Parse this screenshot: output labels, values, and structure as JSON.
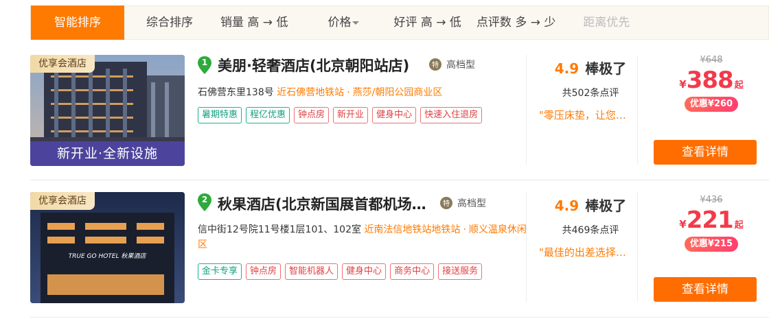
{
  "sort_bar": {
    "tabs": [
      {
        "label": "智能排序"
      },
      {
        "label": "综合排序"
      },
      {
        "label": "销量 高 → 低"
      },
      {
        "label": "价格"
      },
      {
        "label": "好评 高 → 低"
      },
      {
        "label": "点评数 多 → 少"
      },
      {
        "label": "距离优先"
      }
    ],
    "active_index": 0,
    "accent_color": "#ff7a00"
  },
  "hotels": [
    {
      "rank": "1",
      "name": "美朋·轻奢酒店(北京朝阳站店)",
      "grade": "高档型",
      "member_tag": "优享会酒店",
      "photo_promo": "新开业·全新设施",
      "address": "石佛营东里138号",
      "nearby": "近石佛营地铁站",
      "area": "燕莎/朝阳公园商业区",
      "tags": [
        {
          "label": "暑期特惠",
          "style": "green"
        },
        {
          "label": "程亿优惠",
          "style": "green"
        },
        {
          "label": "钟点房",
          "style": "red"
        },
        {
          "label": "新开业",
          "style": "red"
        },
        {
          "label": "健身中心",
          "style": "red"
        },
        {
          "label": "快速入住退房",
          "style": "red"
        }
      ],
      "score": "4.9",
      "score_word": "棒极了",
      "reviews": "共502条点评",
      "quote": "\"零压床垫，让您…",
      "original_price": "¥648",
      "currency": "¥",
      "price": "388",
      "price_suffix": "起",
      "discount": "优惠¥260",
      "detail_label": "查看详情"
    },
    {
      "rank": "2",
      "name": "秋果酒店(北京新国展首都机场…",
      "grade": "高档型",
      "member_tag": "优享会酒店",
      "photo_sign": "TRUE GO HOTEL 秋果酒店",
      "address": "信中街12号院11号楼1层101、102室",
      "nearby": "近南法信地铁站地铁站",
      "area": "顺义温泉休闲区",
      "tags": [
        {
          "label": "金卡专享",
          "style": "green"
        },
        {
          "label": "钟点房",
          "style": "red"
        },
        {
          "label": "智能机器人",
          "style": "red"
        },
        {
          "label": "健身中心",
          "style": "red"
        },
        {
          "label": "商务中心",
          "style": "red"
        },
        {
          "label": "接送服务",
          "style": "red"
        }
      ],
      "score": "4.9",
      "score_word": "棒极了",
      "reviews": "共469条点评",
      "quote": "\"最佳的出差选择…",
      "original_price": "¥436",
      "currency": "¥",
      "price": "221",
      "price_suffix": "起",
      "discount": "优惠¥215",
      "detail_label": "查看详情"
    }
  ],
  "colors": {
    "score": "#ff7a00",
    "price": "#f33a4a",
    "button": "#ff6d00",
    "rank_badge": "#2eaa3c",
    "green_tag": "#13a080",
    "red_tag": "#e04040"
  }
}
